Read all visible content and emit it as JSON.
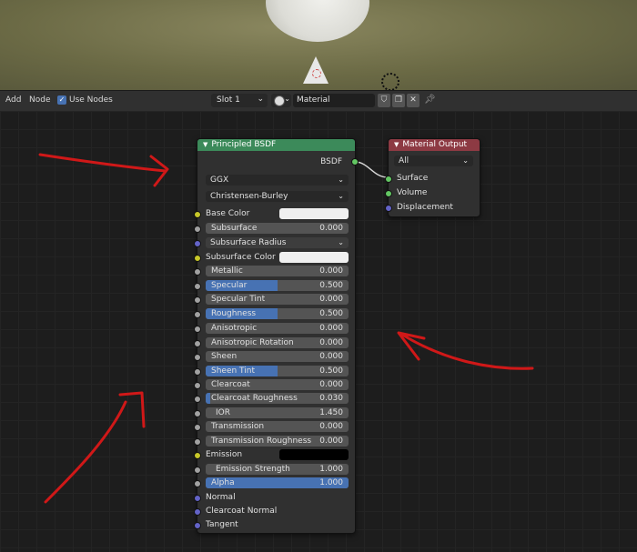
{
  "header": {
    "add": "Add",
    "node": "Node",
    "use_nodes": "Use Nodes",
    "use_nodes_check": "✓",
    "slot": "Slot 1",
    "material": "Material"
  },
  "bsdf": {
    "title": "Principled BSDF",
    "output": "BSDF",
    "distribution": "GGX",
    "subsurface_method": "Christensen-Burley",
    "rows": {
      "base_color": "Base Color",
      "subsurface": {
        "label": "Subsurface",
        "value": "0.000"
      },
      "subsurface_radius": "Subsurface Radius",
      "subsurface_color": "Subsurface Color",
      "metallic": {
        "label": "Metallic",
        "value": "0.000"
      },
      "specular": {
        "label": "Specular",
        "value": "0.500",
        "fill": 0.5
      },
      "specular_tint": {
        "label": "Specular Tint",
        "value": "0.000"
      },
      "roughness": {
        "label": "Roughness",
        "value": "0.500",
        "fill": 0.5
      },
      "anisotropic": {
        "label": "Anisotropic",
        "value": "0.000"
      },
      "anisotropic_rotation": {
        "label": "Anisotropic Rotation",
        "value": "0.000"
      },
      "sheen": {
        "label": "Sheen",
        "value": "0.000"
      },
      "sheen_tint": {
        "label": "Sheen Tint",
        "value": "0.500",
        "fill": 0.5
      },
      "clearcoat": {
        "label": "Clearcoat",
        "value": "0.000"
      },
      "clearcoat_roughness": {
        "label": "Clearcoat Roughness",
        "value": "0.030",
        "fill": 0.03
      },
      "ior": {
        "label": "IOR",
        "value": "1.450"
      },
      "transmission": {
        "label": "Transmission",
        "value": "0.000"
      },
      "transmission_roughness": {
        "label": "Transmission Roughness",
        "value": "0.000"
      },
      "emission": "Emission",
      "emission_strength": {
        "label": "Emission Strength",
        "value": "1.000"
      },
      "alpha": {
        "label": "Alpha",
        "value": "1.000",
        "fill": 1.0
      },
      "normal": "Normal",
      "clearcoat_normal": "Clearcoat Normal",
      "tangent": "Tangent"
    }
  },
  "output": {
    "title": "Material Output",
    "target": "All",
    "surface": "Surface",
    "volume": "Volume",
    "displacement": "Displacement"
  },
  "colors": {
    "bsdf_header": "#3c8a5a",
    "output_header": "#8d3a43",
    "accent": "#4772b3",
    "arrow": "#d01818"
  }
}
